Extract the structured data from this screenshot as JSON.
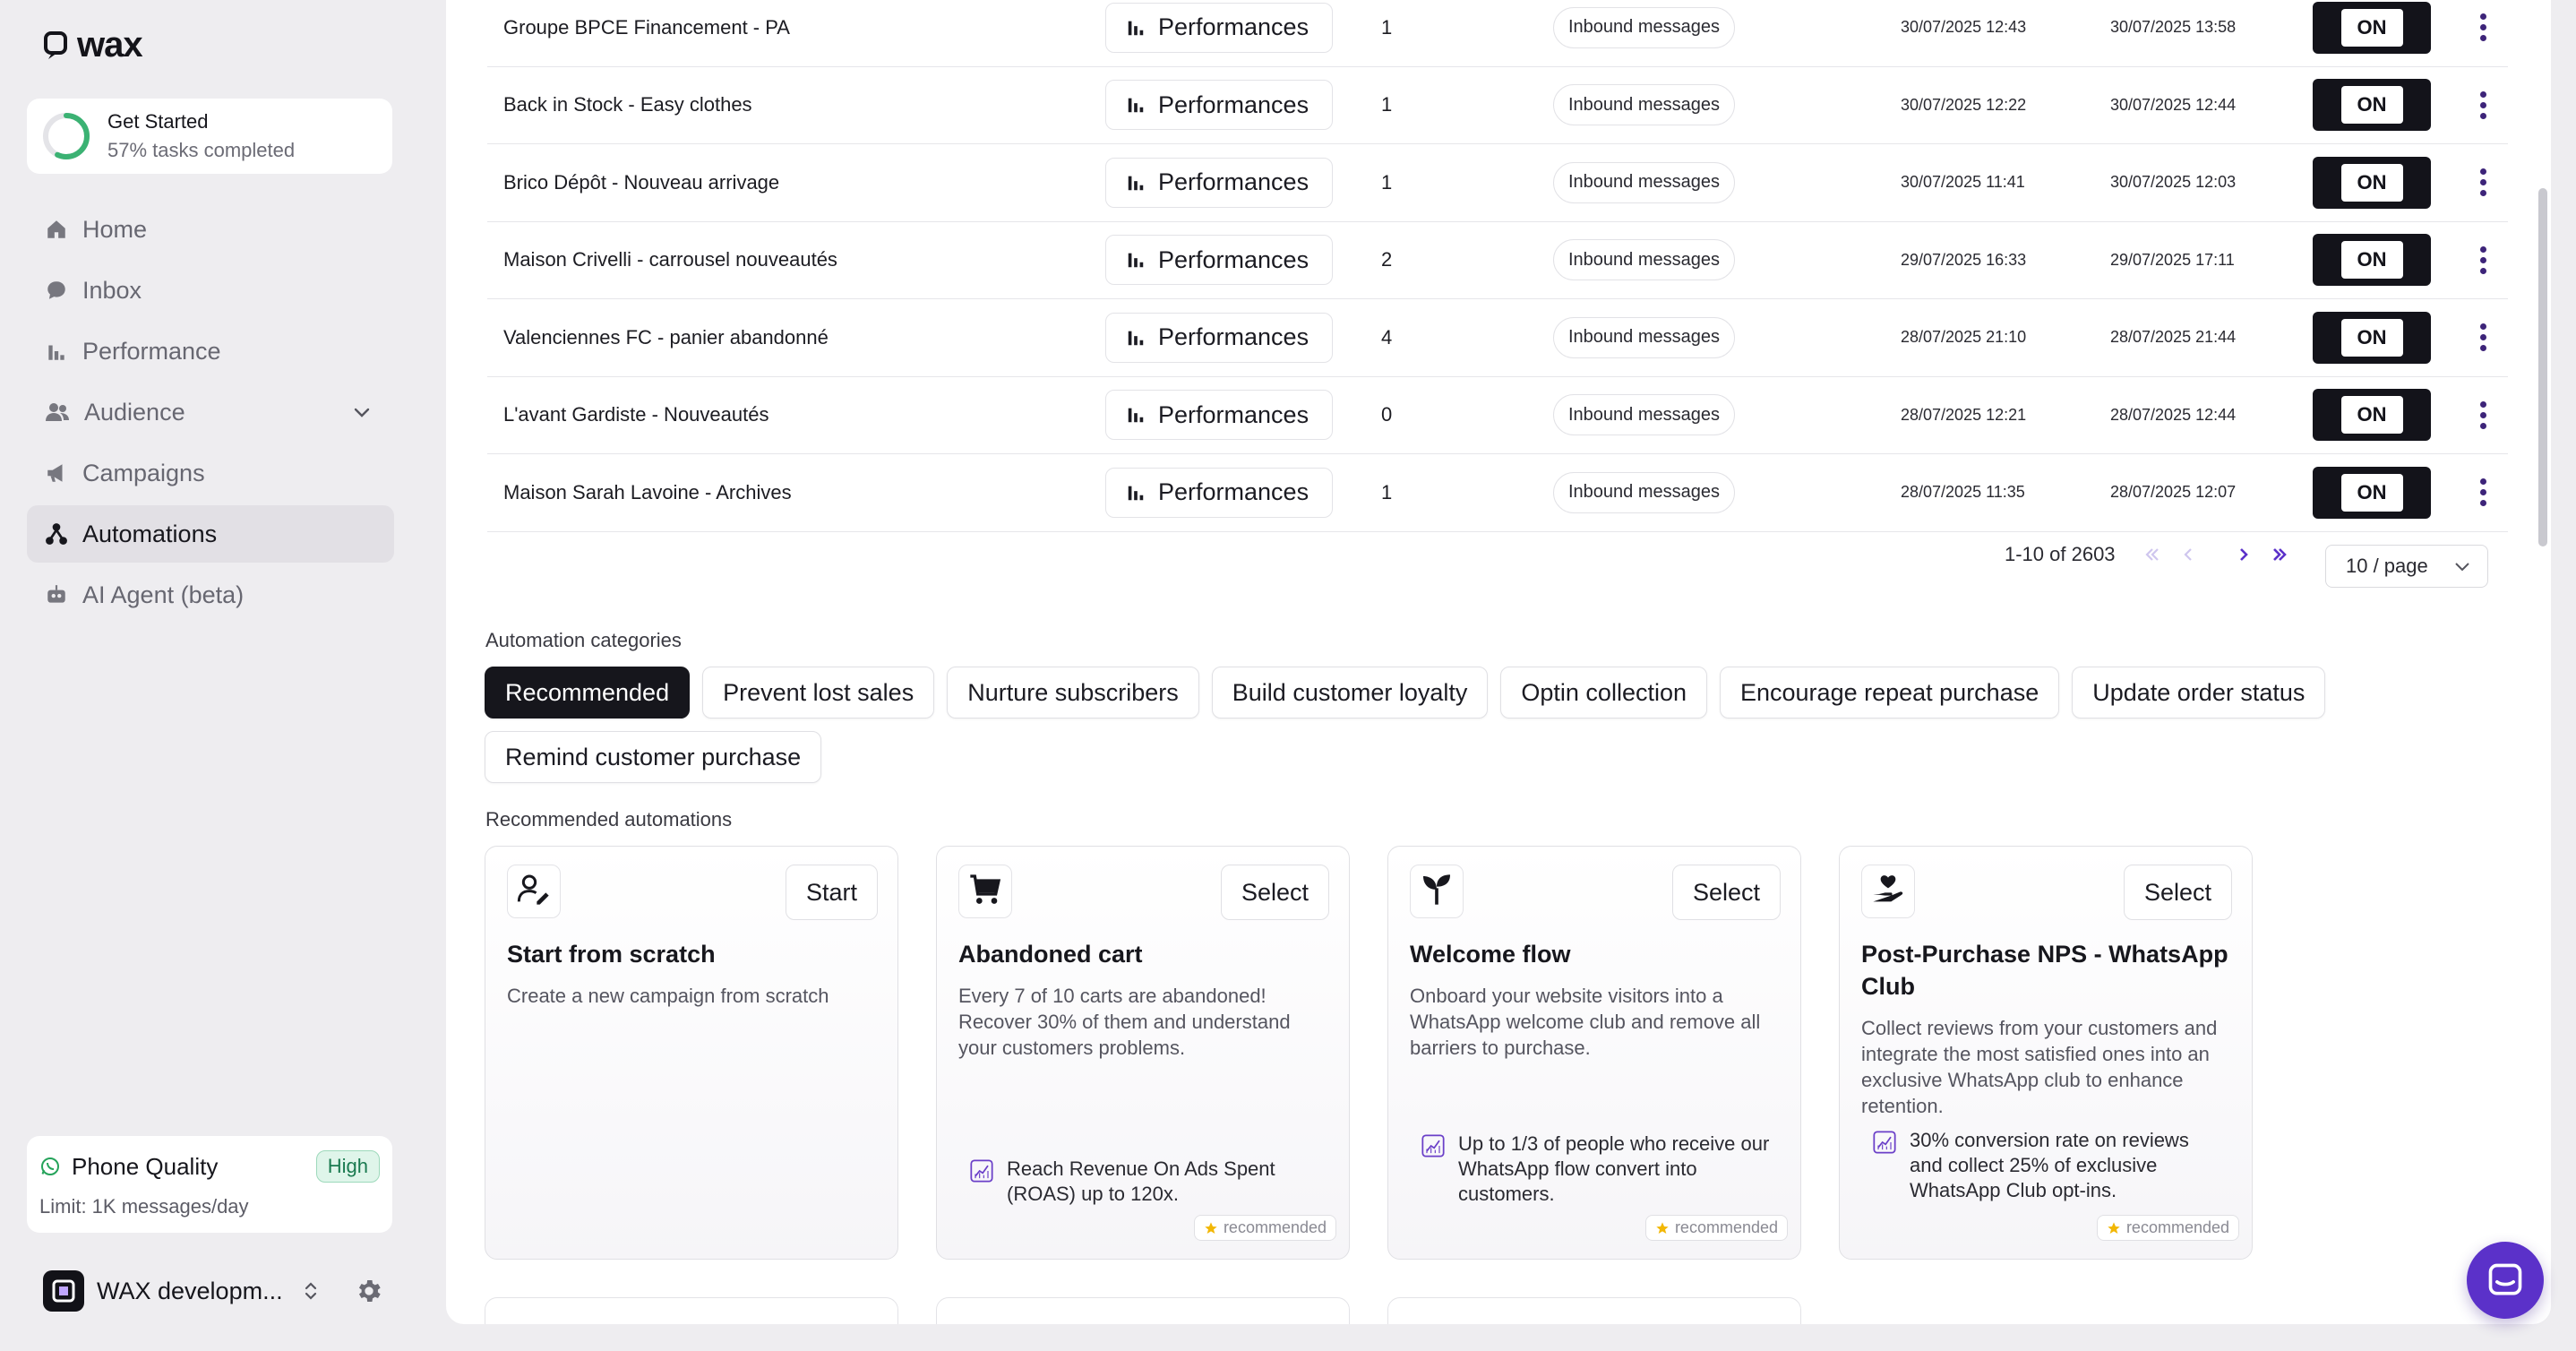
{
  "app": {
    "logo_text": "wax"
  },
  "get_started": {
    "title": "Get Started",
    "subtitle": "57% tasks completed",
    "progress": 0.57
  },
  "nav": [
    {
      "label": "Home",
      "icon": "home-icon"
    },
    {
      "label": "Inbox",
      "icon": "chat-icon"
    },
    {
      "label": "Performance",
      "icon": "bar-chart-icon"
    },
    {
      "label": "Audience",
      "icon": "users-icon"
    },
    {
      "label": "Campaigns",
      "icon": "megaphone-icon"
    },
    {
      "label": "Automations",
      "icon": "automation-icon",
      "active": true
    },
    {
      "label": "AI Agent (beta)",
      "icon": "robot-icon"
    }
  ],
  "phone_quality": {
    "title": "Phone Quality",
    "badge": "High",
    "limit": "Limit: 1K messages/day"
  },
  "workspace": {
    "name": "WAX developm..."
  },
  "table": {
    "rows": [
      {
        "name": "Groupe BPCE Financement - PA",
        "perf": "Performances",
        "count": "1",
        "trigger": "Inbound messages",
        "created": "30/07/2025 12:43",
        "updated": "30/07/2025 13:58",
        "toggle": "ON"
      },
      {
        "name": "Back in Stock - Easy clothes",
        "perf": "Performances",
        "count": "1",
        "trigger": "Inbound messages",
        "created": "30/07/2025 12:22",
        "updated": "30/07/2025 12:44",
        "toggle": "ON"
      },
      {
        "name": "Brico Dépôt - Nouveau arrivage",
        "perf": "Performances",
        "count": "1",
        "trigger": "Inbound messages",
        "created": "30/07/2025 11:41",
        "updated": "30/07/2025 12:03",
        "toggle": "ON"
      },
      {
        "name": "Maison Crivelli - carrousel nouveautés",
        "perf": "Performances",
        "count": "2",
        "trigger": "Inbound messages",
        "created": "29/07/2025 16:33",
        "updated": "29/07/2025 17:11",
        "toggle": "ON"
      },
      {
        "name": "Valenciennes FC - panier abandonné",
        "perf": "Performances",
        "count": "4",
        "trigger": "Inbound messages",
        "created": "28/07/2025 21:10",
        "updated": "28/07/2025 21:44",
        "toggle": "ON"
      },
      {
        "name": "L'avant Gardiste - Nouveautés",
        "perf": "Performances",
        "count": "0",
        "trigger": "Inbound messages",
        "created": "28/07/2025 12:21",
        "updated": "28/07/2025 12:44",
        "toggle": "ON"
      },
      {
        "name": "Maison Sarah Lavoine - Archives",
        "perf": "Performances",
        "count": "1",
        "trigger": "Inbound messages",
        "created": "28/07/2025 11:35",
        "updated": "28/07/2025 12:07",
        "toggle": "ON"
      }
    ]
  },
  "pagination": {
    "range": "1-10 of 2603",
    "page_size": "10 / page"
  },
  "categories": {
    "label": "Automation categories",
    "items": [
      "Recommended",
      "Prevent lost sales",
      "Nurture subscribers",
      "Build customer loyalty",
      "Optin collection",
      "Encourage repeat purchase",
      "Update order status",
      "Remind customer purchase"
    ],
    "active": "Recommended"
  },
  "recommended": {
    "label": "Recommended automations",
    "cards": [
      {
        "icon": "user-edit-icon",
        "button": "Start",
        "title": "Start from scratch",
        "desc": "Create a new campaign from scratch",
        "stat": "",
        "badge": ""
      },
      {
        "icon": "cart-icon",
        "button": "Select",
        "title": "Abandoned cart",
        "desc": "Every 7 of 10 carts are abandoned! Recover 30% of them and understand your customers problems.",
        "stat": "Reach Revenue On Ads Spent (ROAS) up to 120x.",
        "badge": "recommended"
      },
      {
        "icon": "sprout-icon",
        "button": "Select",
        "title": "Welcome flow",
        "desc": "Onboard your website visitors into a WhatsApp welcome club and remove all barriers to purchase.",
        "stat": "Up to 1/3 of people who receive our WhatsApp flow convert into customers.",
        "badge": "recommended"
      },
      {
        "icon": "hand-heart-icon",
        "button": "Select",
        "title": "Post-Purchase NPS - WhatsApp Club",
        "desc": "Collect reviews from your customers and integrate the most satisfied ones into an exclusive WhatsApp club to enhance retention.",
        "stat": "30% conversion rate on reviews and collect 25% of exclusive WhatsApp Club opt-ins.",
        "badge": "recommended"
      }
    ]
  },
  "colors": {
    "accent": "#5b31c9",
    "dark": "#16161c",
    "badge_green": "#1a7a50"
  }
}
